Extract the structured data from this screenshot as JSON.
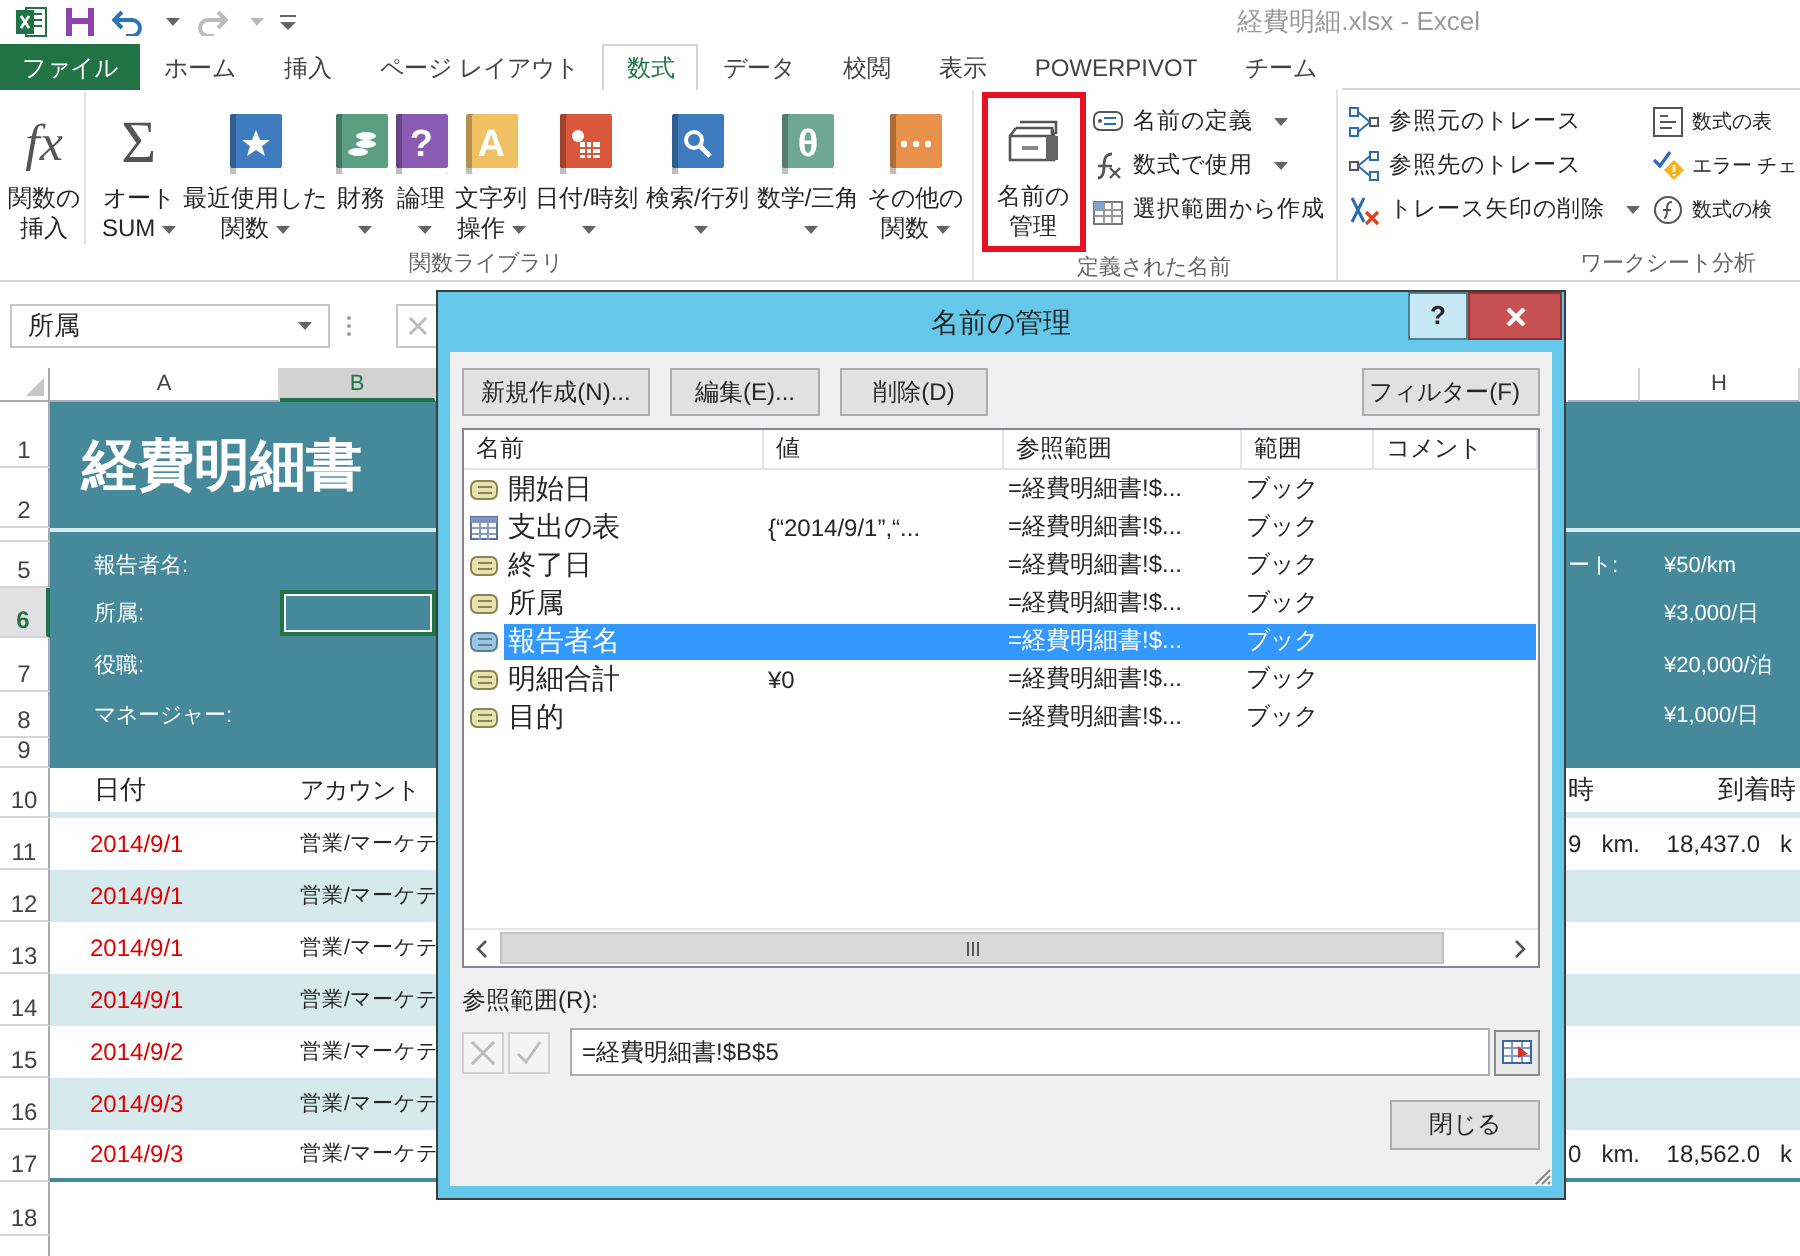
{
  "title_bar": {
    "title": "経費明細.xlsx - Excel"
  },
  "ribbon_tabs": [
    {
      "label": "ファイル",
      "kind": "file",
      "selected": false
    },
    {
      "label": "ホーム",
      "kind": "tab",
      "selected": false
    },
    {
      "label": "挿入",
      "kind": "tab",
      "selected": false
    },
    {
      "label": "ページ レイアウト",
      "kind": "tab",
      "selected": false
    },
    {
      "label": "数式",
      "kind": "tab",
      "selected": true
    },
    {
      "label": "データ",
      "kind": "tab",
      "selected": false
    },
    {
      "label": "校閲",
      "kind": "tab",
      "selected": false
    },
    {
      "label": "表示",
      "kind": "tab",
      "selected": false
    },
    {
      "label": "POWERPIVOT",
      "kind": "tab",
      "selected": false
    },
    {
      "label": "チーム",
      "kind": "tab",
      "selected": false
    }
  ],
  "ribbon_groups": [
    {
      "label": "関数ライブラリ",
      "large": [
        {
          "lines": [
            "関数の",
            "挿入"
          ],
          "kind": "glyph",
          "glyph": "fx",
          "dropdown": false,
          "highlighted": false
        },
        {
          "lines": [
            "オート",
            "SUM"
          ],
          "kind": "glyph",
          "glyph": "Σ",
          "dropdown": true,
          "highlighted": false
        },
        {
          "lines": [
            "最近使用した",
            "関数"
          ],
          "kind": "star-book",
          "color": "#3f7cbf",
          "dropdown": true,
          "highlighted": false
        },
        {
          "lines": [
            "財務"
          ],
          "kind": "coins-book",
          "color": "#5b9e82",
          "dropdown": true,
          "highlighted": false
        },
        {
          "lines": [
            "論理"
          ],
          "kind": "glyph-book",
          "glyph": "?",
          "color": "#8a5bb3",
          "dropdown": true,
          "highlighted": false
        },
        {
          "lines": [
            "文字列",
            "操作"
          ],
          "kind": "glyph-book",
          "glyph": "A",
          "color": "#f0c163",
          "dropdown": true,
          "highlighted": false
        },
        {
          "lines": [
            "日付/時刻"
          ],
          "kind": "calendar-book",
          "color": "#d9573b",
          "dropdown": true,
          "highlighted": false
        },
        {
          "lines": [
            "検索/行列"
          ],
          "kind": "search-book",
          "color": "#3f7cbf",
          "dropdown": true,
          "highlighted": false
        },
        {
          "lines": [
            "数学/三角"
          ],
          "kind": "glyph-book",
          "glyph": "θ",
          "color": "#6fa795",
          "dropdown": true,
          "highlighted": false
        },
        {
          "lines": [
            "その他の",
            "関数"
          ],
          "kind": "dots-book",
          "color": "#e8914b",
          "dropdown": true,
          "highlighted": false
        }
      ]
    },
    {
      "label": "定義された名前",
      "large": [
        {
          "lines": [
            "名前の",
            "管理"
          ],
          "kind": "name-manager",
          "dropdown": false,
          "highlighted": true
        }
      ],
      "small_columns": [
        [
          {
            "label": "名前の定義",
            "kind": "define",
            "dropdown": true
          },
          {
            "label": "数式で使用",
            "kind": "use",
            "dropdown": true
          },
          {
            "label": "選択範囲から作成",
            "kind": "create",
            "dropdown": false
          }
        ]
      ]
    },
    {
      "label": "ワークシート分析",
      "small_columns": [
        [
          {
            "label": "参照元のトレース",
            "kind": "precedents",
            "dropdown": false
          },
          {
            "label": "参照先のトレース",
            "kind": "dependents",
            "dropdown": false
          },
          {
            "label": "トレース矢印の削除",
            "kind": "remove-arrows",
            "dropdown": true
          }
        ],
        [
          {
            "label": "数式の表",
            "kind": "show-formulas",
            "dropdown": false
          },
          {
            "label": "エラー チェ",
            "kind": "error-check",
            "dropdown": false
          },
          {
            "label": "数式の検",
            "kind": "evaluate",
            "dropdown": false
          }
        ]
      ]
    }
  ],
  "formula_bar": {
    "name_box": "所属"
  },
  "sheet": {
    "columns": [
      {
        "label": "A",
        "selected": false
      },
      {
        "label": "B",
        "selected": true
      },
      {
        "label": "H",
        "selected": false
      }
    ],
    "title_rows": [
      "1",
      "2"
    ],
    "title": "経費明細書",
    "info_rows": [
      {
        "number": "5",
        "label": "報告者名:",
        "rate_label": "ート:",
        "rate": "¥50/km",
        "selected": false
      },
      {
        "number": "6",
        "label": "所属:",
        "rate": "¥3,000/日",
        "selected": true
      },
      {
        "number": "7",
        "label": "役職:",
        "rate": "¥20,000/泊",
        "selected": false
      },
      {
        "number": "8",
        "label": "マネージャー:",
        "rate": "¥1,000/日",
        "selected": false
      }
    ],
    "spacer_row": "9",
    "header_row": {
      "number": "10",
      "date": "日付",
      "account": "アカウント",
      "start": "時",
      "end": "到着時"
    },
    "data_rows": [
      {
        "number": "11",
        "date": "2014/9/1",
        "account": "営業/マーケテ",
        "start": "9",
        "start_unit": "km.",
        "end": "18,437.0",
        "end_unit": "k"
      },
      {
        "number": "12",
        "date": "2014/9/1",
        "account": "営業/マーケテ"
      },
      {
        "number": "13",
        "date": "2014/9/1",
        "account": "営業/マーケテ"
      },
      {
        "number": "14",
        "date": "2014/9/1",
        "account": "営業/マーケテ"
      },
      {
        "number": "15",
        "date": "2014/9/2",
        "account": "営業/マーケテ"
      },
      {
        "number": "16",
        "date": "2014/9/3",
        "account": "営業/マーケテ"
      },
      {
        "number": "17",
        "date": "2014/9/3",
        "account": "営業/マーケテ",
        "start": "0",
        "start_unit": "km.",
        "end": "18,562.0",
        "end_unit": "k"
      }
    ],
    "empty_rows": [
      "18"
    ]
  },
  "dialog": {
    "title": "名前の管理",
    "help": "?",
    "buttons": [
      "新規作成(N)...",
      "編集(E)...",
      "削除(D)"
    ],
    "filter": "フィルター(F)",
    "columns": [
      "名前",
      "値",
      "参照範囲",
      "範囲",
      "コメント"
    ],
    "rows": [
      {
        "kind": "name",
        "name": "開始日",
        "value": "",
        "refers_to": "=経費明細書!$...",
        "scope": "ブック",
        "selected": false
      },
      {
        "kind": "table",
        "name": "支出の表",
        "value": "{“2014/9/1”,“...",
        "refers_to": "=経費明細書!$...",
        "scope": "ブック",
        "selected": false
      },
      {
        "kind": "name",
        "name": "終了日",
        "value": "",
        "refers_to": "=経費明細書!$...",
        "scope": "ブック",
        "selected": false
      },
      {
        "kind": "name",
        "name": "所属",
        "value": "",
        "refers_to": "=経費明細書!$...",
        "scope": "ブック",
        "selected": false
      },
      {
        "kind": "name",
        "name": "報告者名",
        "value": "",
        "refers_to": "=経費明細書!$...",
        "scope": "ブック",
        "selected": true
      },
      {
        "kind": "name",
        "name": "明細合計",
        "value": "¥0",
        "refers_to": "=経費明細書!$...",
        "scope": "ブック",
        "selected": false
      },
      {
        "kind": "name",
        "name": "目的",
        "value": "",
        "refers_to": "=経費明細書!$...",
        "scope": "ブック",
        "selected": false
      }
    ],
    "refers_label": "参照範囲(R):",
    "refers_value": "=経費明細書!$B$5",
    "close_button": "閉じる"
  }
}
